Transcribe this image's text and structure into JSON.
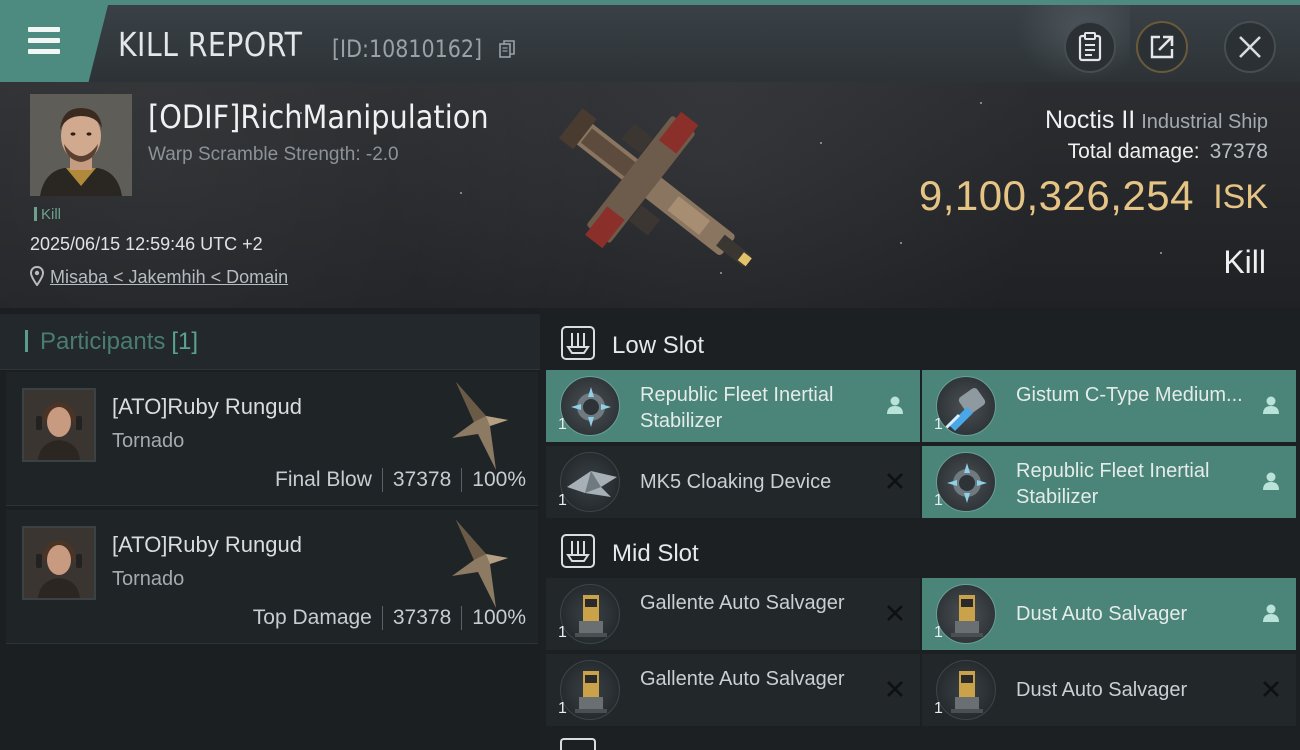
{
  "header": {
    "title": "KILL REPORT",
    "report_id": "[ID:10810162]"
  },
  "victim": {
    "name": "[ODIF]RichManipulation",
    "warp_scramble": "Warp Scramble Strength: -2.0",
    "tag": "Kill",
    "datetime": "2025/06/15 12:59:46 UTC +2",
    "location": "Misaba < Jakemhih < Domain",
    "ship_name": "Noctis II",
    "ship_class": "Industrial Ship",
    "total_damage_label": "Total damage:",
    "total_damage": "37378",
    "isk_value": "9,100,326,254",
    "isk_unit": "ISK",
    "result": "Kill"
  },
  "participants": {
    "label": "Participants",
    "count": "[1]",
    "rows": [
      {
        "name": "[ATO]Ruby Rungud",
        "ship": "Tornado",
        "role": "Final Blow",
        "damage": "37378",
        "percent": "100%"
      },
      {
        "name": "[ATO]Ruby Rungud",
        "ship": "Tornado",
        "role": "Top Damage",
        "damage": "37378",
        "percent": "100%"
      }
    ]
  },
  "low_slot": {
    "label": "Low Slot",
    "modules": [
      {
        "name": "Republic Fleet Inertial Stabilizer",
        "qty": "1",
        "status": "person-icon",
        "active": true
      },
      {
        "name": "Gistum C-Type Medium...",
        "qty": "1",
        "status": "person-icon",
        "active": true
      },
      {
        "name": "MK5 Cloaking Device",
        "qty": "1",
        "status": "x-icon",
        "active": false
      },
      {
        "name": "Republic Fleet Inertial Stabilizer",
        "qty": "1",
        "status": "person-icon",
        "active": true
      }
    ]
  },
  "mid_slot": {
    "label": "Mid Slot",
    "modules": [
      {
        "name": "Gallente Auto Salvager",
        "qty": "1",
        "status": "x-icon",
        "active": false
      },
      {
        "name": "Dust Auto Salvager",
        "qty": "1",
        "status": "person-icon",
        "active": true
      },
      {
        "name": "Gallente Auto Salvager",
        "qty": "1",
        "status": "x-icon",
        "active": false
      },
      {
        "name": "Dust Auto Salvager",
        "qty": "1",
        "status": "x-icon",
        "active": false
      }
    ]
  },
  "colors": {
    "accent": "#4d8a80",
    "active_row": "#4b8479",
    "isk_gold": "#e6c485",
    "panel_dark": "#1f2427"
  }
}
